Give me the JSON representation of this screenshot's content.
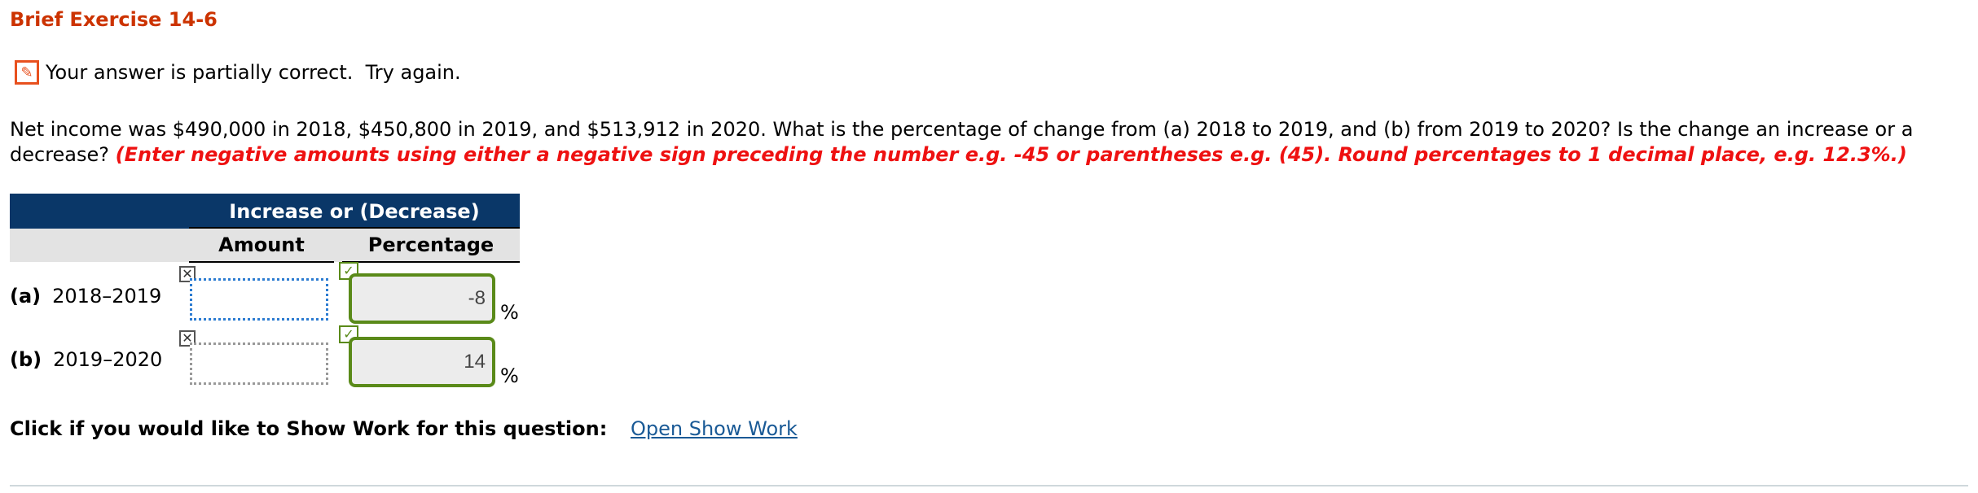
{
  "exercise_title": "Brief Exercise 14-6",
  "status": {
    "icon": "pencil-icon",
    "text": "Your answer is partially correct.  Try again."
  },
  "question": {
    "text": "Net income was $490,000 in 2018, $450,800 in 2019, and $513,912 in 2020. What is the percentage of change from (a) 2018 to 2019, and (b) from 2019 to 2020? Is the change an increase or a decrease? ",
    "instruction": "(Enter negative amounts using either a negative sign preceding the number e.g. -45 or parentheses e.g. (45). Round percentages to 1 decimal place, e.g. 12.3%.)"
  },
  "table": {
    "header_title": "Increase or (Decrease)",
    "col_amount": "Amount",
    "col_percentage": "Percentage",
    "rows": [
      {
        "letter": "(a)",
        "period": "2018–2019",
        "amount": "",
        "amount_status": "incorrect",
        "percentage": "-8",
        "percentage_status": "correct",
        "unit": "%"
      },
      {
        "letter": "(b)",
        "period": "2019–2020",
        "amount": "",
        "amount_status": "incorrect",
        "percentage": "14",
        "percentage_status": "correct",
        "unit": "%"
      }
    ]
  },
  "show_work": {
    "prompt": "Click if you would like to Show Work for this question:",
    "link": "Open Show Work"
  },
  "colors": {
    "title": "#cc3300",
    "instruction": "#ee1111",
    "header_bg": "#0a3768",
    "correct": "#5a8a19",
    "link": "#1a5a96"
  }
}
